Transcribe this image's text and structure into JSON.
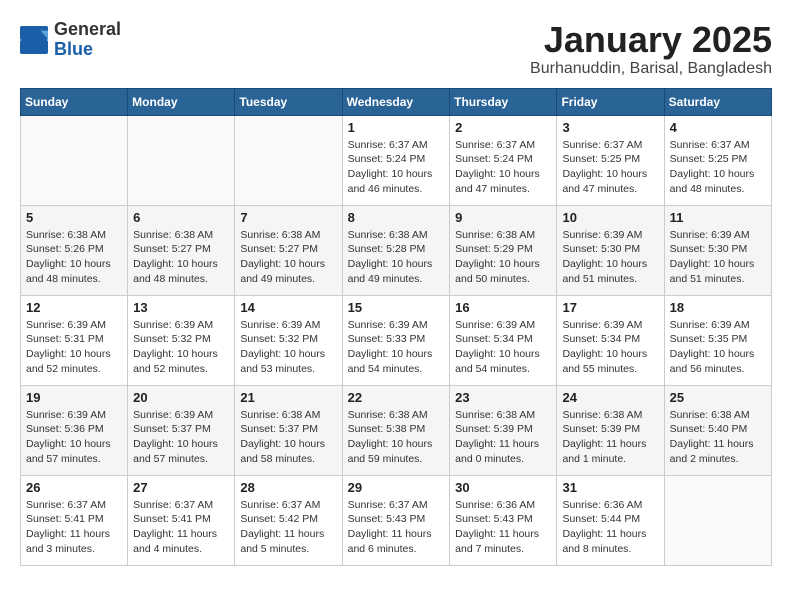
{
  "logo": {
    "general": "General",
    "blue": "Blue"
  },
  "title": "January 2025",
  "location": "Burhanuddin, Barisal, Bangladesh",
  "weekdays": [
    "Sunday",
    "Monday",
    "Tuesday",
    "Wednesday",
    "Thursday",
    "Friday",
    "Saturday"
  ],
  "weeks": [
    [
      {
        "day": "",
        "info": ""
      },
      {
        "day": "",
        "info": ""
      },
      {
        "day": "",
        "info": ""
      },
      {
        "day": "1",
        "info": "Sunrise: 6:37 AM\nSunset: 5:24 PM\nDaylight: 10 hours\nand 46 minutes."
      },
      {
        "day": "2",
        "info": "Sunrise: 6:37 AM\nSunset: 5:24 PM\nDaylight: 10 hours\nand 47 minutes."
      },
      {
        "day": "3",
        "info": "Sunrise: 6:37 AM\nSunset: 5:25 PM\nDaylight: 10 hours\nand 47 minutes."
      },
      {
        "day": "4",
        "info": "Sunrise: 6:37 AM\nSunset: 5:25 PM\nDaylight: 10 hours\nand 48 minutes."
      }
    ],
    [
      {
        "day": "5",
        "info": "Sunrise: 6:38 AM\nSunset: 5:26 PM\nDaylight: 10 hours\nand 48 minutes."
      },
      {
        "day": "6",
        "info": "Sunrise: 6:38 AM\nSunset: 5:27 PM\nDaylight: 10 hours\nand 48 minutes."
      },
      {
        "day": "7",
        "info": "Sunrise: 6:38 AM\nSunset: 5:27 PM\nDaylight: 10 hours\nand 49 minutes."
      },
      {
        "day": "8",
        "info": "Sunrise: 6:38 AM\nSunset: 5:28 PM\nDaylight: 10 hours\nand 49 minutes."
      },
      {
        "day": "9",
        "info": "Sunrise: 6:38 AM\nSunset: 5:29 PM\nDaylight: 10 hours\nand 50 minutes."
      },
      {
        "day": "10",
        "info": "Sunrise: 6:39 AM\nSunset: 5:30 PM\nDaylight: 10 hours\nand 51 minutes."
      },
      {
        "day": "11",
        "info": "Sunrise: 6:39 AM\nSunset: 5:30 PM\nDaylight: 10 hours\nand 51 minutes."
      }
    ],
    [
      {
        "day": "12",
        "info": "Sunrise: 6:39 AM\nSunset: 5:31 PM\nDaylight: 10 hours\nand 52 minutes."
      },
      {
        "day": "13",
        "info": "Sunrise: 6:39 AM\nSunset: 5:32 PM\nDaylight: 10 hours\nand 52 minutes."
      },
      {
        "day": "14",
        "info": "Sunrise: 6:39 AM\nSunset: 5:32 PM\nDaylight: 10 hours\nand 53 minutes."
      },
      {
        "day": "15",
        "info": "Sunrise: 6:39 AM\nSunset: 5:33 PM\nDaylight: 10 hours\nand 54 minutes."
      },
      {
        "day": "16",
        "info": "Sunrise: 6:39 AM\nSunset: 5:34 PM\nDaylight: 10 hours\nand 54 minutes."
      },
      {
        "day": "17",
        "info": "Sunrise: 6:39 AM\nSunset: 5:34 PM\nDaylight: 10 hours\nand 55 minutes."
      },
      {
        "day": "18",
        "info": "Sunrise: 6:39 AM\nSunset: 5:35 PM\nDaylight: 10 hours\nand 56 minutes."
      }
    ],
    [
      {
        "day": "19",
        "info": "Sunrise: 6:39 AM\nSunset: 5:36 PM\nDaylight: 10 hours\nand 57 minutes."
      },
      {
        "day": "20",
        "info": "Sunrise: 6:39 AM\nSunset: 5:37 PM\nDaylight: 10 hours\nand 57 minutes."
      },
      {
        "day": "21",
        "info": "Sunrise: 6:38 AM\nSunset: 5:37 PM\nDaylight: 10 hours\nand 58 minutes."
      },
      {
        "day": "22",
        "info": "Sunrise: 6:38 AM\nSunset: 5:38 PM\nDaylight: 10 hours\nand 59 minutes."
      },
      {
        "day": "23",
        "info": "Sunrise: 6:38 AM\nSunset: 5:39 PM\nDaylight: 11 hours\nand 0 minutes."
      },
      {
        "day": "24",
        "info": "Sunrise: 6:38 AM\nSunset: 5:39 PM\nDaylight: 11 hours\nand 1 minute."
      },
      {
        "day": "25",
        "info": "Sunrise: 6:38 AM\nSunset: 5:40 PM\nDaylight: 11 hours\nand 2 minutes."
      }
    ],
    [
      {
        "day": "26",
        "info": "Sunrise: 6:37 AM\nSunset: 5:41 PM\nDaylight: 11 hours\nand 3 minutes."
      },
      {
        "day": "27",
        "info": "Sunrise: 6:37 AM\nSunset: 5:41 PM\nDaylight: 11 hours\nand 4 minutes."
      },
      {
        "day": "28",
        "info": "Sunrise: 6:37 AM\nSunset: 5:42 PM\nDaylight: 11 hours\nand 5 minutes."
      },
      {
        "day": "29",
        "info": "Sunrise: 6:37 AM\nSunset: 5:43 PM\nDaylight: 11 hours\nand 6 minutes."
      },
      {
        "day": "30",
        "info": "Sunrise: 6:36 AM\nSunset: 5:43 PM\nDaylight: 11 hours\nand 7 minutes."
      },
      {
        "day": "31",
        "info": "Sunrise: 6:36 AM\nSunset: 5:44 PM\nDaylight: 11 hours\nand 8 minutes."
      },
      {
        "day": "",
        "info": ""
      }
    ]
  ]
}
